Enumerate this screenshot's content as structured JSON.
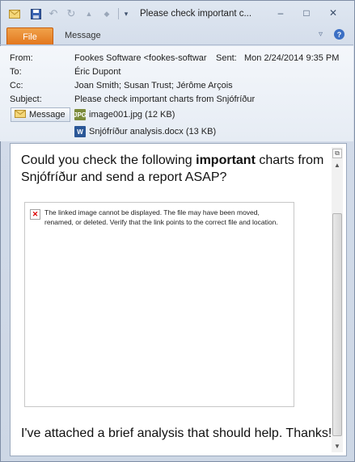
{
  "window": {
    "title": "Please check important c...",
    "icons": [
      "envelope-icon",
      "save-icon",
      "undo-icon",
      "redo-icon",
      "up-icon",
      "down-icon",
      "customize-icon"
    ],
    "controls": {
      "minimize": "–",
      "maximize": "□",
      "close": "✕"
    }
  },
  "ribbon": {
    "tabs": [
      {
        "label": "File",
        "active": true
      },
      {
        "label": "Message",
        "active": false
      }
    ],
    "help": "?",
    "collapse": "▿"
  },
  "header": {
    "from_label": "From:",
    "from_value": "Fookes Software <fookes-softwar",
    "sent_label": "Sent:",
    "sent_value": "Mon 2/24/2014 9:35 PM",
    "to_label": "To:",
    "to_value": "Éric Dupont",
    "cc_label": "Cc:",
    "cc_value": "Joan Smith; Susan Trust; Jérôme Arçois",
    "subject_label": "Subject:",
    "subject_value": "Please check important charts from Snjófríður"
  },
  "attachments_bar": {
    "message_button": "Message",
    "items": [
      {
        "name": "image001.jpg (12 KB)",
        "icon": "jpg-file-icon"
      },
      {
        "name": "Snjófríður analysis.docx (13 KB)",
        "icon": "word-file-icon"
      }
    ]
  },
  "body": {
    "intro_before": "Could you check the following ",
    "intro_bold": "important",
    "intro_after": " charts from Snjófríður and send a report ASAP?",
    "broken_image_message": "The linked image cannot be displayed.  The file may have been moved, renamed, or deleted. Verify that the link points to the correct file and location.",
    "closing": "I've attached a brief analysis that should help. Thanks!"
  },
  "colors": {
    "file_tab": "#e2751c",
    "window_bg": "#d3dcea",
    "broken_image_x": "#dd0000"
  }
}
